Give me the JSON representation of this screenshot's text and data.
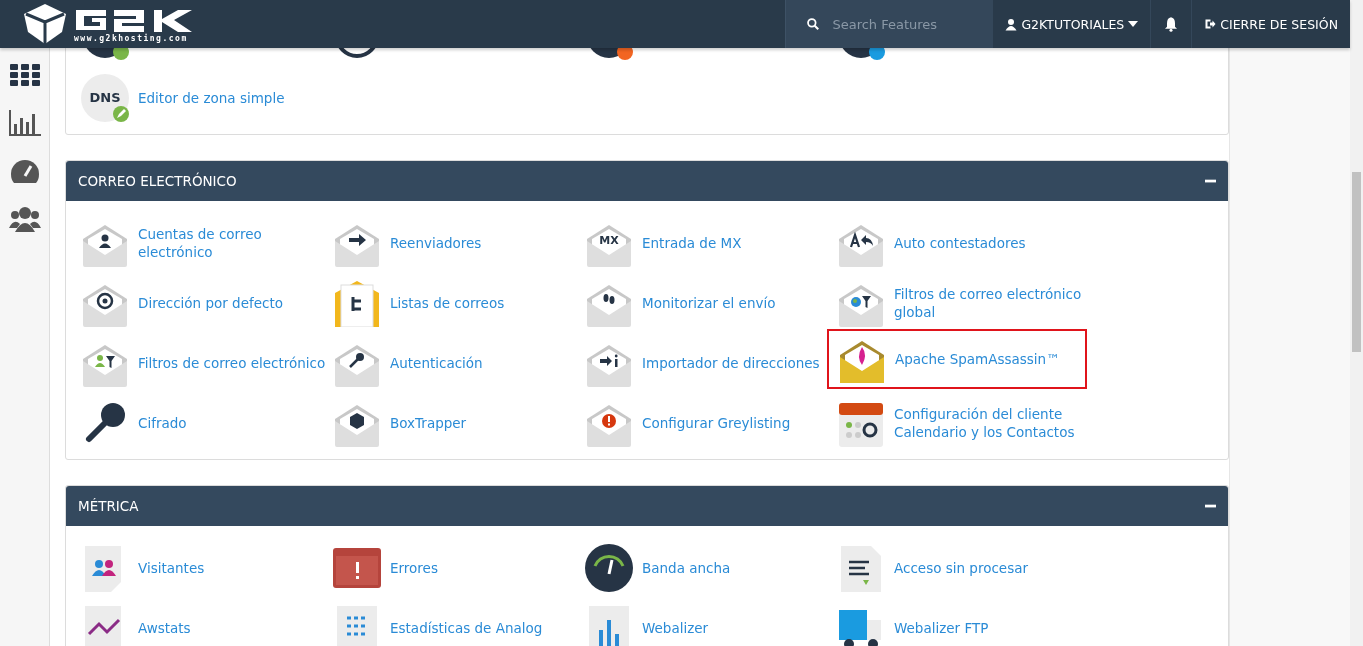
{
  "header": {
    "logo_text": "www.g2khosting.com",
    "search": {
      "placeholder": "Search Features"
    },
    "user": "G2KTUTORIALES",
    "logout": "CIERRE DE SESIÓN"
  },
  "sections": [
    {
      "items": [
        {
          "selected": false
        },
        {
          "selected": false
        },
        {
          "selected": false
        },
        {
          "selected": false
        },
        {
          "icon_text": "DNS",
          "label": "Editor de zona simple",
          "selected": false
        }
      ]
    },
    {
      "title": "CORREO ELECTRÓNICO",
      "expanded": true,
      "items": [
        {
          "label": "Cuentas de correo electrónico",
          "selected": false
        },
        {
          "label": "Reenviadores",
          "selected": false
        },
        {
          "icon_text": "MX",
          "label": "Entrada de MX",
          "selected": false
        },
        {
          "label": "Auto contestadores",
          "selected": false
        },
        {
          "label": "Dirección por defecto",
          "selected": false
        },
        {
          "label": "Listas de correos",
          "selected": false
        },
        {
          "label": "Monitorizar el envío",
          "selected": false
        },
        {
          "label": "Filtros de correo electrónico global",
          "selected": false
        },
        {
          "label": "Filtros de correo electrónico",
          "selected": false
        },
        {
          "label": "Autenticación",
          "selected": false
        },
        {
          "label": "Importador de direcciones",
          "selected": false
        },
        {
          "label": "Apache SpamAssassin™",
          "selected": true
        },
        {
          "label": "Cifrado",
          "selected": false
        },
        {
          "label": "BoxTrapper",
          "selected": false
        },
        {
          "label": "Configurar Greylisting",
          "selected": false
        },
        {
          "label": "Configuración del cliente Calendario y los Contactos",
          "selected": false
        }
      ]
    },
    {
      "title": "MÉTRICA",
      "expanded": true,
      "items": [
        {
          "label": "Visitantes",
          "selected": false
        },
        {
          "label": "Errores",
          "selected": false
        },
        {
          "label": "Banda ancha",
          "selected": false
        },
        {
          "label": "Acceso sin procesar",
          "selected": false
        },
        {
          "label": "Awstats",
          "selected": false
        },
        {
          "label": "Estadísticas de Analog",
          "selected": false
        },
        {
          "label": "Webalizer",
          "selected": false
        },
        {
          "label": "Webalizer FTP",
          "selected": false
        }
      ]
    }
  ]
}
